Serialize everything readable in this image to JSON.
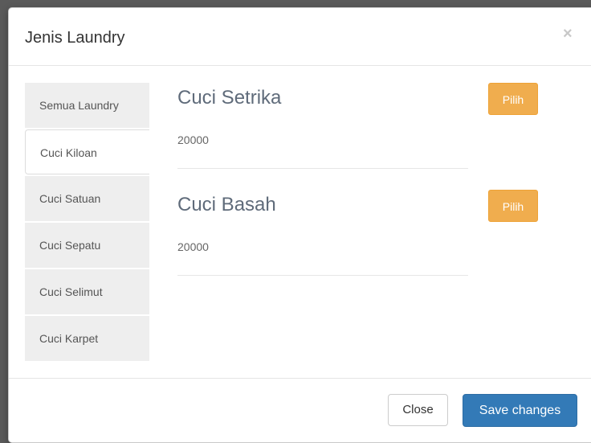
{
  "modal": {
    "title": "Jenis Laundry",
    "close_symbol": "×"
  },
  "tabs": [
    {
      "label": "Semua Laundry",
      "active": false
    },
    {
      "label": "Cuci Kiloan",
      "active": true
    },
    {
      "label": "Cuci Satuan",
      "active": false
    },
    {
      "label": "Cuci Sepatu",
      "active": false
    },
    {
      "label": "Cuci Selimut",
      "active": false
    },
    {
      "label": "Cuci Karpet",
      "active": false
    }
  ],
  "items": [
    {
      "name": "Cuci Setrika",
      "price": "20000",
      "button_label": "Pilih"
    },
    {
      "name": "Cuci Basah",
      "price": "20000",
      "button_label": "Pilih"
    }
  ],
  "footer": {
    "close_label": "Close",
    "save_label": "Save changes"
  },
  "colors": {
    "primary": "#337ab7",
    "warning": "#f0ad4e",
    "tab_bg": "#eeeeee"
  }
}
